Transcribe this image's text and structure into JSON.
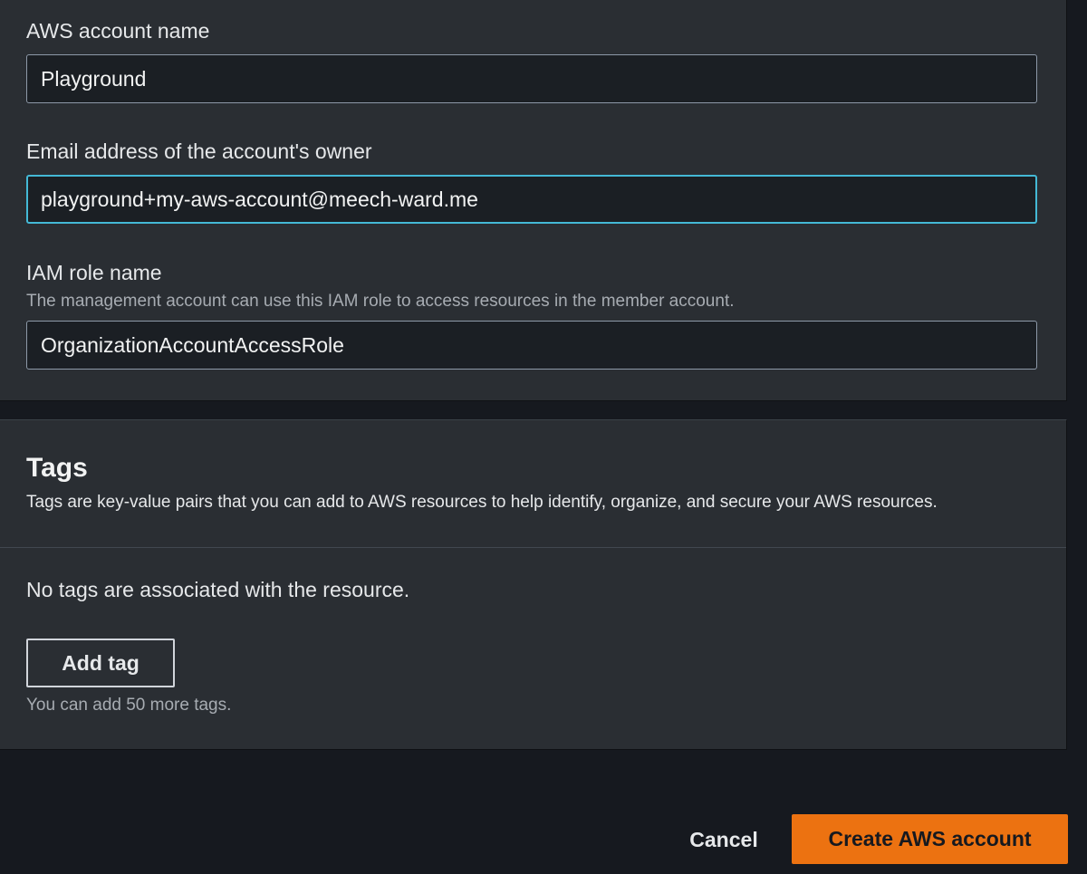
{
  "account_details": {
    "account_name": {
      "label": "AWS account name",
      "value": "Playground"
    },
    "email": {
      "label": "Email address of the account's owner",
      "value": "playground+my-aws-account@meech-ward.me"
    },
    "iam_role": {
      "label": "IAM role name",
      "description": "The management account can use this IAM role to access resources in the member account.",
      "value": "OrganizationAccountAccessRole"
    }
  },
  "tags": {
    "title": "Tags",
    "description": "Tags are key-value pairs that you can add to AWS resources to help identify, organize, and secure your AWS resources.",
    "empty_message": "No tags are associated with the resource.",
    "add_button_label": "Add tag",
    "limit_text": "You can add 50 more tags."
  },
  "footer": {
    "cancel_label": "Cancel",
    "create_label": "Create AWS account"
  },
  "colors": {
    "primary_button": "#ec7211",
    "focus_ring": "#44b9d6",
    "page_background": "#16191f",
    "panel_background": "#2a2e33"
  }
}
